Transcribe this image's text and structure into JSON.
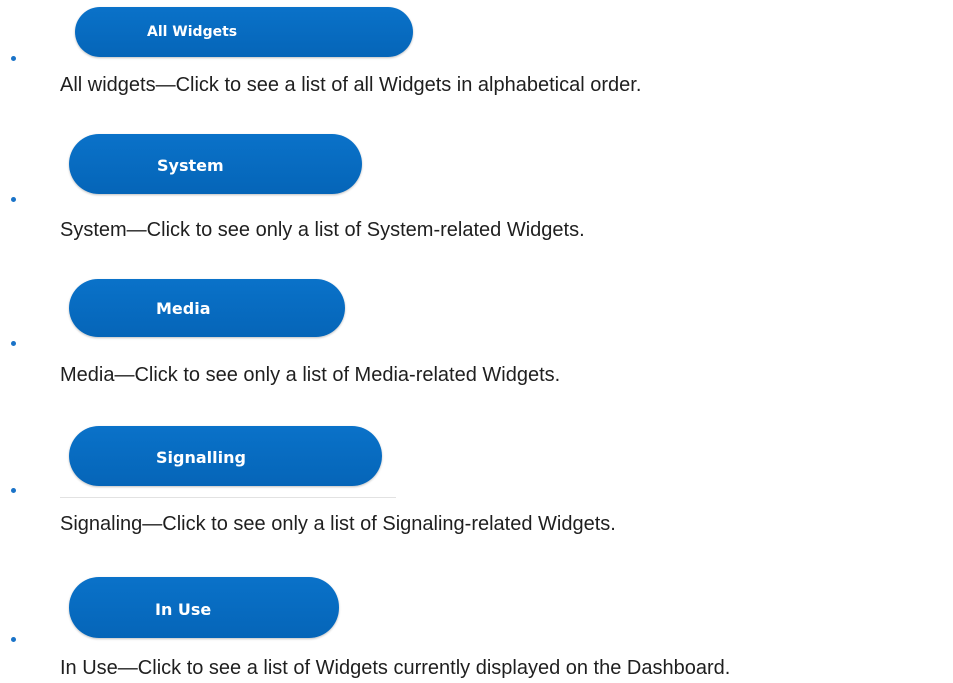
{
  "items": [
    {
      "button_label": "All Widgets",
      "description": "All widgets—Click to see a list of all Widgets in alphabetical order."
    },
    {
      "button_label": "System",
      "description": "System—Click to see only a list of System-related Widgets."
    },
    {
      "button_label": "Media",
      "description": "Media—Click to see only a list of Media-related Widgets."
    },
    {
      "button_label": "Signalling",
      "description": "Signaling—Click to see only a list of Signaling-related Widgets."
    },
    {
      "button_label": "In Use",
      "description": "In Use—Click to see a list of Widgets currently displayed on the Dashboard."
    }
  ],
  "colors": {
    "button_blue": "#0a72c9",
    "bullet_blue": "#1a73c8",
    "text": "#1f1f1f"
  }
}
